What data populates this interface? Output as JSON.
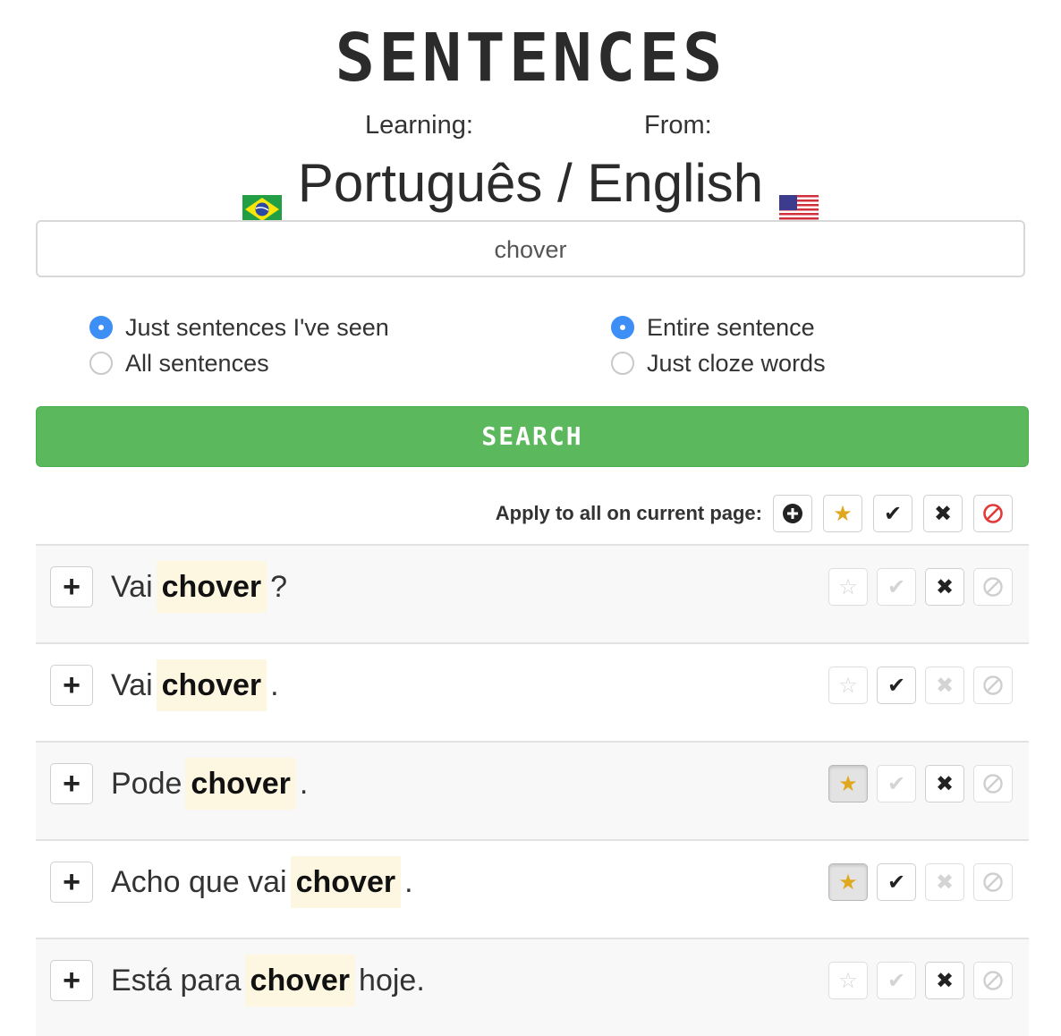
{
  "header": {
    "title": "SENTENCES",
    "learning_label": "Learning:",
    "from_label": "From:",
    "language_pair": "Português / English"
  },
  "search": {
    "value": "chover"
  },
  "filters": {
    "scope": [
      {
        "label": "Just sentences I've seen",
        "checked": true
      },
      {
        "label": "All sentences",
        "checked": false
      }
    ],
    "match": [
      {
        "label": "Entire sentence",
        "checked": true
      },
      {
        "label": "Just cloze words",
        "checked": false
      }
    ]
  },
  "search_button": "SEARCH",
  "apply_all": {
    "label": "Apply to all on current page:",
    "icons": [
      "add-circle-icon",
      "star-icon",
      "check-icon",
      "x-icon",
      "ban-icon"
    ]
  },
  "sentences": [
    {
      "before": "Vai",
      "word": "chover",
      "after": "?",
      "star": "off",
      "check": "dim",
      "x": "on",
      "ban": "dim"
    },
    {
      "before": "Vai",
      "word": "chover",
      "after": ".",
      "star": "off",
      "check": "on",
      "x": "dim",
      "ban": "dim"
    },
    {
      "before": "Pode",
      "word": "chover",
      "after": ".",
      "star": "active",
      "check": "dim",
      "x": "on",
      "ban": "dim"
    },
    {
      "before": "Acho que vai",
      "word": "chover",
      "after": ".",
      "star": "active",
      "check": "on",
      "x": "dim",
      "ban": "dim"
    },
    {
      "before": "Está para",
      "word": "chover",
      "after": "hoje.",
      "star": "off",
      "check": "dim",
      "x": "on",
      "ban": "dim"
    }
  ],
  "colors": {
    "accent_green": "#5cb85c",
    "radio_blue": "#3d8ef5",
    "star_gold": "#e0a81e",
    "ban_red": "#e03a3a",
    "highlight": "#fdf6e0"
  }
}
